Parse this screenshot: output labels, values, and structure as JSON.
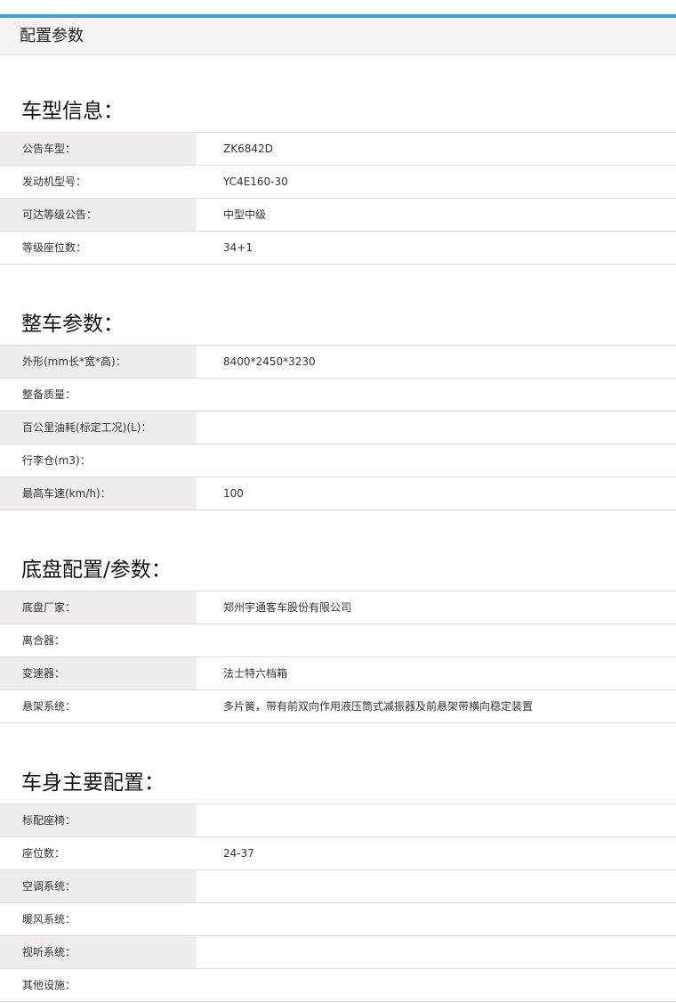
{
  "header": {
    "title": "配置参数"
  },
  "accent_color": "#3d9fd8",
  "sections": [
    {
      "title": "车型信息：",
      "rows": [
        {
          "label": "公告车型：",
          "value": "ZK6842D"
        },
        {
          "label": "发动机型号：",
          "value": "YC4E160-30"
        },
        {
          "label": "可达等级公告：",
          "value": "中型中级"
        },
        {
          "label": "等级座位数：",
          "value": "34+1"
        }
      ]
    },
    {
      "title": "整车参数：",
      "rows": [
        {
          "label": "外形(mm长*宽*高)：",
          "value": "8400*2450*3230"
        },
        {
          "label": "整备质量：",
          "value": ""
        },
        {
          "label": "百公里油耗(标定工况)(L)：",
          "value": ""
        },
        {
          "label": "行李仓(m3)：",
          "value": ""
        },
        {
          "label": "最高车速(km/h)：",
          "value": "100"
        }
      ]
    },
    {
      "title": "底盘配置/参数：",
      "rows": [
        {
          "label": "底盘厂家：",
          "value": "郑州宇通客车股份有限公司"
        },
        {
          "label": "离合器：",
          "value": ""
        },
        {
          "label": "变速器：",
          "value": "法士特六档箱"
        },
        {
          "label": "悬架系统：",
          "value": "多片簧，带有前双向作用液压筒式减振器及前悬架带横向稳定装置"
        }
      ]
    },
    {
      "title": "车身主要配置：",
      "rows": [
        {
          "label": "标配座椅：",
          "value": ""
        },
        {
          "label": "座位数：",
          "value": "24-37"
        },
        {
          "label": "空调系统：",
          "value": ""
        },
        {
          "label": "暖风系统：",
          "value": ""
        },
        {
          "label": "视听系统：",
          "value": ""
        },
        {
          "label": "其他设施：",
          "value": ""
        }
      ]
    }
  ]
}
